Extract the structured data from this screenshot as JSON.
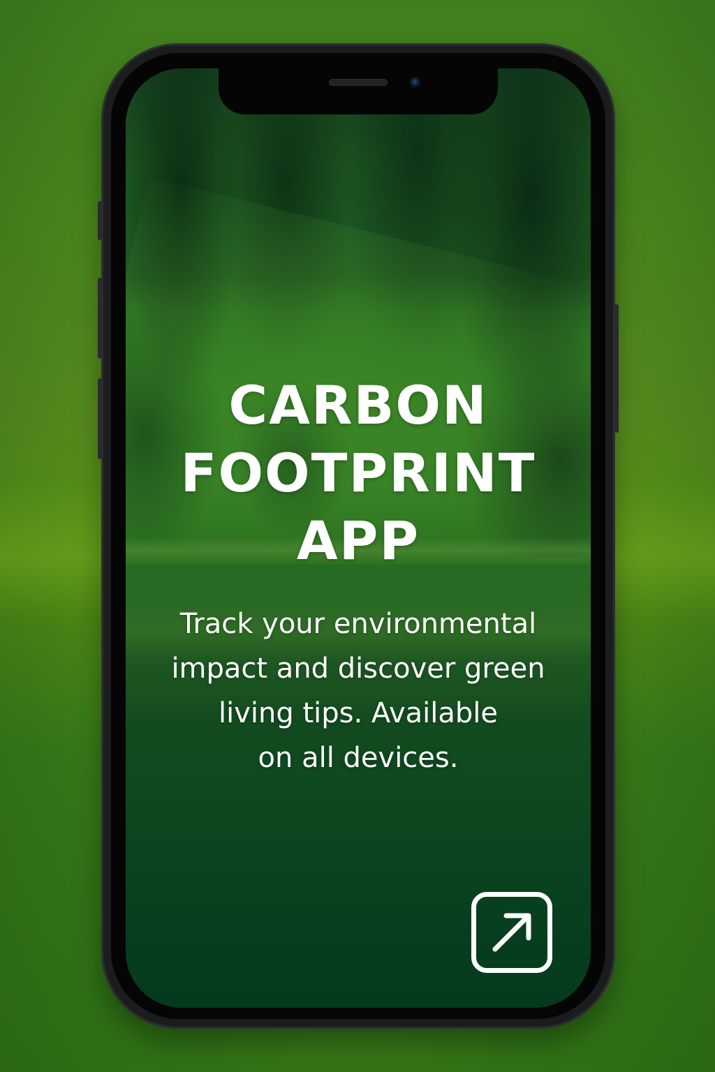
{
  "app": {
    "title_lines": [
      "CARBON",
      "FOOTPRINT",
      "APP"
    ],
    "description_lines": [
      "Track your environmental",
      "impact and discover green",
      "living tips. Available",
      "on all devices."
    ]
  },
  "actions": {
    "open_icon": "external-arrow-icon"
  },
  "colors": {
    "accent_green": "#2e7015",
    "text": "#ffffff"
  }
}
